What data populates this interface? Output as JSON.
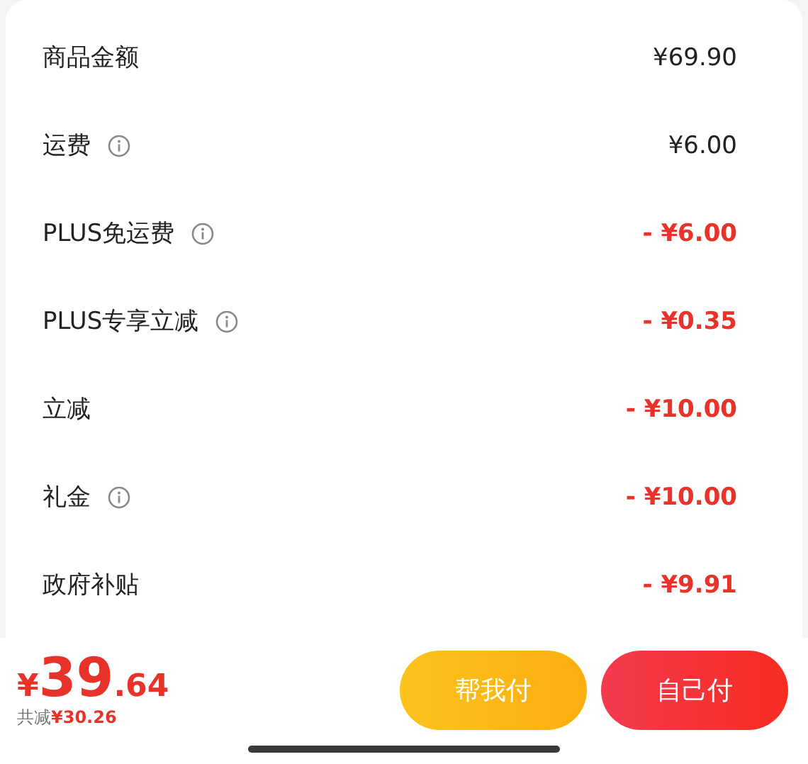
{
  "rows": [
    {
      "label": "商品金额",
      "info": false,
      "value": "¥69.90",
      "kind": "charge"
    },
    {
      "label": "运费",
      "info": true,
      "value": "¥6.00",
      "kind": "charge"
    },
    {
      "label": "PLUS免运费",
      "info": true,
      "value": "- ¥6.00",
      "kind": "discount"
    },
    {
      "label": "PLUS专享立减",
      "info": true,
      "value": "- ¥0.35",
      "kind": "discount"
    },
    {
      "label": "立减",
      "info": false,
      "value": "- ¥10.00",
      "kind": "discount"
    },
    {
      "label": "礼金",
      "info": true,
      "value": "- ¥10.00",
      "kind": "discount"
    },
    {
      "label": "政府补贴",
      "info": false,
      "value": "- ¥9.91",
      "kind": "discount"
    }
  ],
  "total": {
    "currency": "¥",
    "integer": "39",
    "decimal": ".64",
    "saved_label": "共减",
    "saved_value": "¥30.26"
  },
  "buttons": [
    {
      "label": "帮我付",
      "kind": "secondary"
    },
    {
      "label": "自己付",
      "kind": "primary"
    }
  ]
}
